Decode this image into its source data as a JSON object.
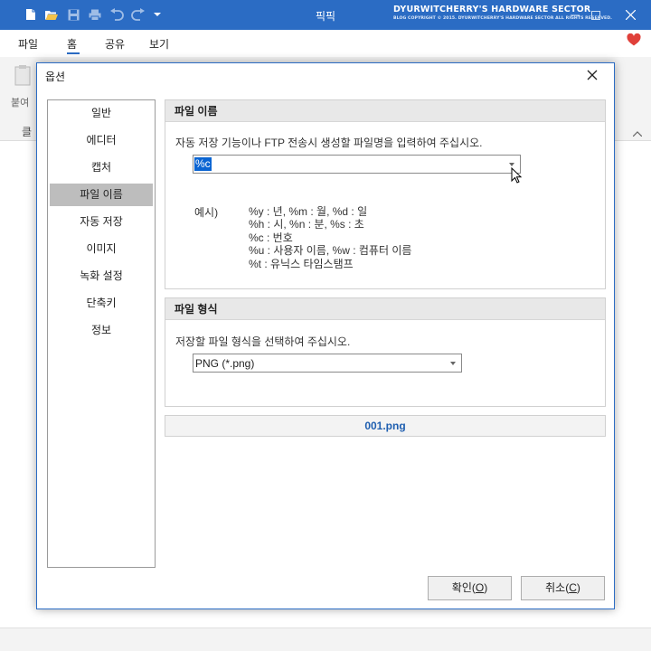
{
  "app": {
    "title": "픽픽",
    "brand": "DYURWITCHERRY'S HARDWARE SECTOR",
    "brand_sub": "BLOG COPYRIGHT © 2015. DYURWITCHERRY'S HARDWARE SECTOR ALL RIGHTS RESERVED."
  },
  "ribbon": {
    "tabs": [
      "파일",
      "홈",
      "공유",
      "보기"
    ],
    "active_tab": "홈",
    "paste_label": "붙여",
    "clipboard_label": "클"
  },
  "dialog": {
    "title": "옵션",
    "nav": [
      "일반",
      "에디터",
      "캡처",
      "파일 이름",
      "자동 저장",
      "이미지",
      "녹화 설정",
      "단축키",
      "정보"
    ],
    "selected_nav": "파일 이름",
    "filename_group": {
      "header": "파일 이름",
      "description": "자동 저장 기능이나 FTP 전송시 생성할 파일명을 입력하여 주십시오.",
      "value": "%c",
      "example_label": "예시)",
      "examples": [
        "%y : 년, %m : 월, %d : 일",
        "%h : 시, %n : 분, %s : 초",
        "%c : 번호",
        "%u : 사용자 이름, %w : 컴퓨터 이름",
        "%t : 유닉스 타임스탬프"
      ]
    },
    "format_group": {
      "header": "파일 형식",
      "description": "저장할 파일 형식을 선택하여 주십시오.",
      "value": "PNG (*.png)"
    },
    "result": "001.png",
    "buttons": {
      "ok_text": "확인(",
      "ok_key": "O",
      "ok_end": ")",
      "cancel_text": "취소(",
      "cancel_key": "C",
      "cancel_end": ")"
    }
  },
  "colors": {
    "titlebar": "#2b6cc4",
    "selection": "#0a64d2",
    "result_text": "#1f5fb0",
    "heart": "#e0403a"
  }
}
